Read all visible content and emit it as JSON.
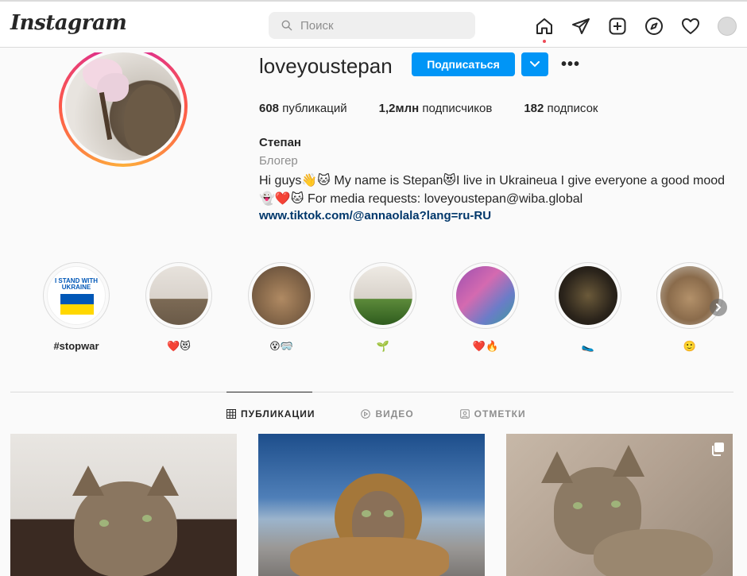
{
  "header": {
    "logo": "Instagram",
    "search_placeholder": "Поиск",
    "nav_icons": [
      "home-icon",
      "direct-icon",
      "new-post-icon",
      "explore-icon",
      "activity-icon",
      "profile-avatar"
    ]
  },
  "profile": {
    "username": "loveyoustepan",
    "follow_label": "Подписаться",
    "more_label": "•••",
    "stats": {
      "posts_count": "608",
      "posts_label": "публикаций",
      "followers_count": "1,2млн",
      "followers_label": "подписчиков",
      "following_count": "182",
      "following_label": "подписок"
    },
    "bio": {
      "name": "Степан",
      "category": "Блогер",
      "line1": "Hi guys👋🐱 My name is Stepan😻I live in Ukraineua I give everyone a good mood",
      "line2": "👻❤️🐱 For media requests: loveyoustepan@wiba.global",
      "link": "www.tiktok.com/@annaolala?lang=ru-RU"
    }
  },
  "stories": [
    {
      "label": "#stopwar",
      "cover": "I STAND WITH UKRAINE"
    },
    {
      "label": "❤️😻"
    },
    {
      "label": "😵🥽"
    },
    {
      "label": "🌱"
    },
    {
      "label": "❤️🔥"
    },
    {
      "label": "🥿"
    },
    {
      "label": "🙂"
    }
  ],
  "tabs": [
    {
      "label": "ПУБЛИКАЦИИ",
      "icon": "grid-icon",
      "active": true
    },
    {
      "label": "ВИДЕО",
      "icon": "play-icon",
      "active": false
    },
    {
      "label": "ОТМЕТКИ",
      "icon": "tag-icon",
      "active": false
    }
  ],
  "colors": {
    "accent": "#0095f6",
    "link": "#00376b",
    "text": "#262626",
    "muted": "#8e8e8e",
    "border": "#dbdbdb",
    "notification": "#ed4956"
  }
}
